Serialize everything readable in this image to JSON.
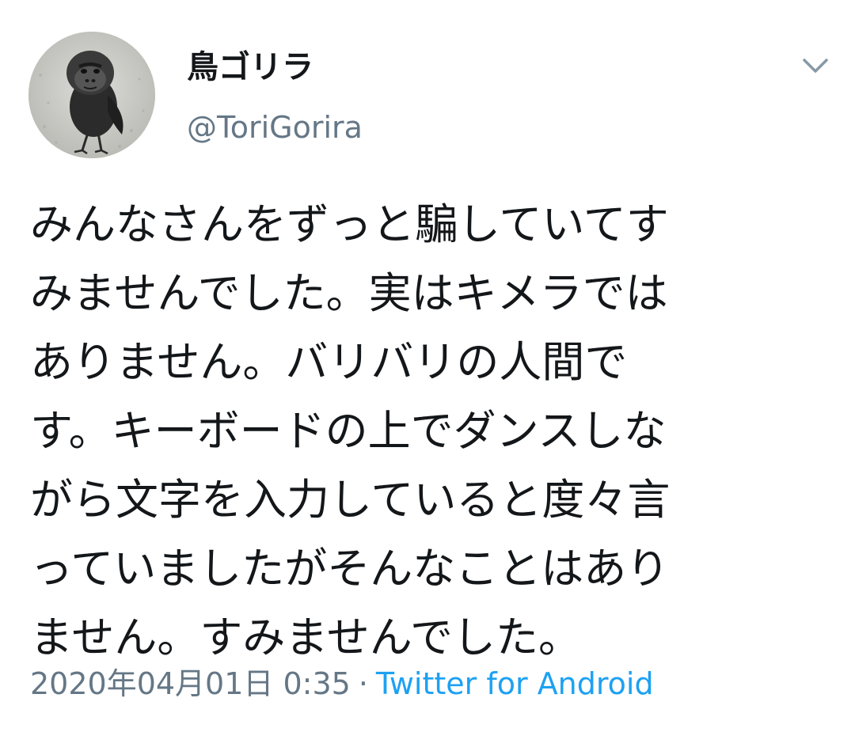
{
  "tweet": {
    "display_name": "鳥ゴリラ",
    "handle": "@ToriGorira",
    "text": "みんなさんをずっと騙していてす\nみませんでした。実はキメラでは\nありません。バリバリの人間で\nす。キーボードの上でダンスしな\nがら文字を入力していると度々言\nっていましたがそんなことはあり\nません。すみませんでした。",
    "timestamp": "2020年04月01日 0:35",
    "separator": "·",
    "source": "Twitter for Android",
    "avatar_icon": "gorilla-bird-avatar",
    "menu_icon": "chevron-down-icon"
  },
  "colors": {
    "text": "#14171a",
    "secondary": "#657786",
    "link": "#1da1f2",
    "background": "#ffffff"
  }
}
